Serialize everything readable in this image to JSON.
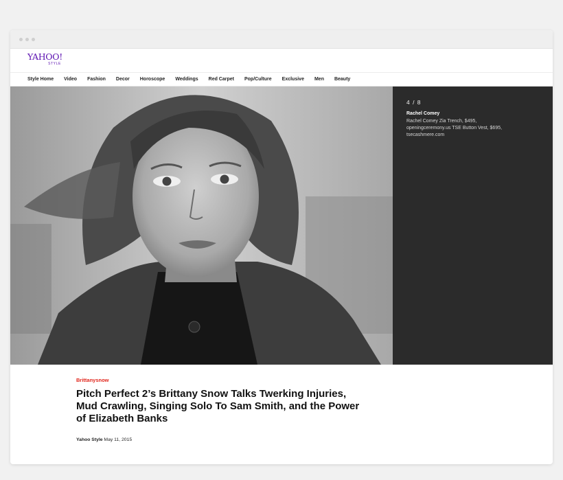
{
  "header": {
    "logo_text": "YAHOO!",
    "logo_sub": "STYLE"
  },
  "nav": {
    "items": [
      "Style Home",
      "Video",
      "Fashion",
      "Decor",
      "Horoscope",
      "Weddings",
      "Red Carpet",
      "Pop/Culture",
      "Exclusive",
      "Men",
      "Beauty"
    ]
  },
  "gallery": {
    "counter": "4 / 8",
    "brand": "Rachel Comey",
    "description": "Rachel Comey Zia Trench, $495, openingceremony.us TSE Button Vest, $695, tsecashmere.com"
  },
  "article": {
    "tag": "Brittanysnow",
    "title": "Pitch Perfect 2’s Brittany Snow Talks Twerking Injuries, Mud Crawling, Singing Solo To Sam Smith, and the Power of Elizabeth Banks",
    "source": "Yahoo Style",
    "date": "May 11, 2015"
  },
  "colors": {
    "brand_purple": "#5a0fb0",
    "tag_red": "#e1251b",
    "panel_bg": "#2b2b2b"
  }
}
